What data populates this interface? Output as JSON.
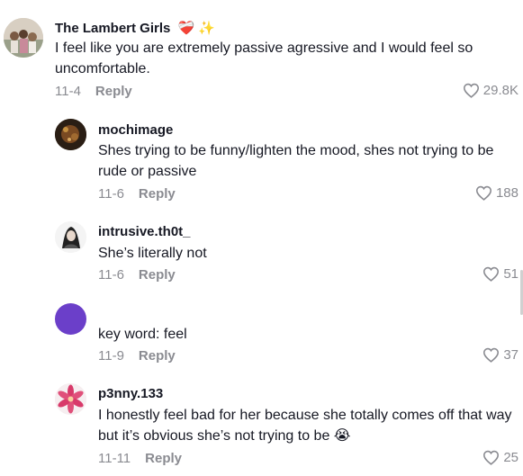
{
  "comments": [
    {
      "username": "The Lambert Girls",
      "username_emojis": "❤️‍🩹 ✨",
      "text": "I feel like you are extremely passive agressive and I would feel so uncomfortable.",
      "date": "11-4",
      "reply_label": "Reply",
      "likes": "29.8K"
    },
    {
      "username": "mochimage",
      "text": "Shes trying to be funny/lighten the mood, shes not trying to be rude or passive",
      "date": "11-6",
      "reply_label": "Reply",
      "likes": "188"
    },
    {
      "username": "intrusive.th0t_",
      "text": "She’s literally not",
      "date": "11-6",
      "reply_label": "Reply",
      "likes": "51"
    },
    {
      "username": "",
      "avatar_color": "#6b3fc9",
      "text": "key word: feel",
      "date": "11-9",
      "reply_label": "Reply",
      "likes": "37"
    },
    {
      "username": "p3nny.133",
      "text": "I honestly feel bad for her because she totally comes off that way but it’s obvious she’s not trying to be 😭",
      "date": "11-11",
      "reply_label": "Reply",
      "likes": "25"
    }
  ],
  "icons": {
    "like": "heart-outline-icon"
  },
  "colors": {
    "meta": "#8a8b91",
    "text": "#161823"
  }
}
